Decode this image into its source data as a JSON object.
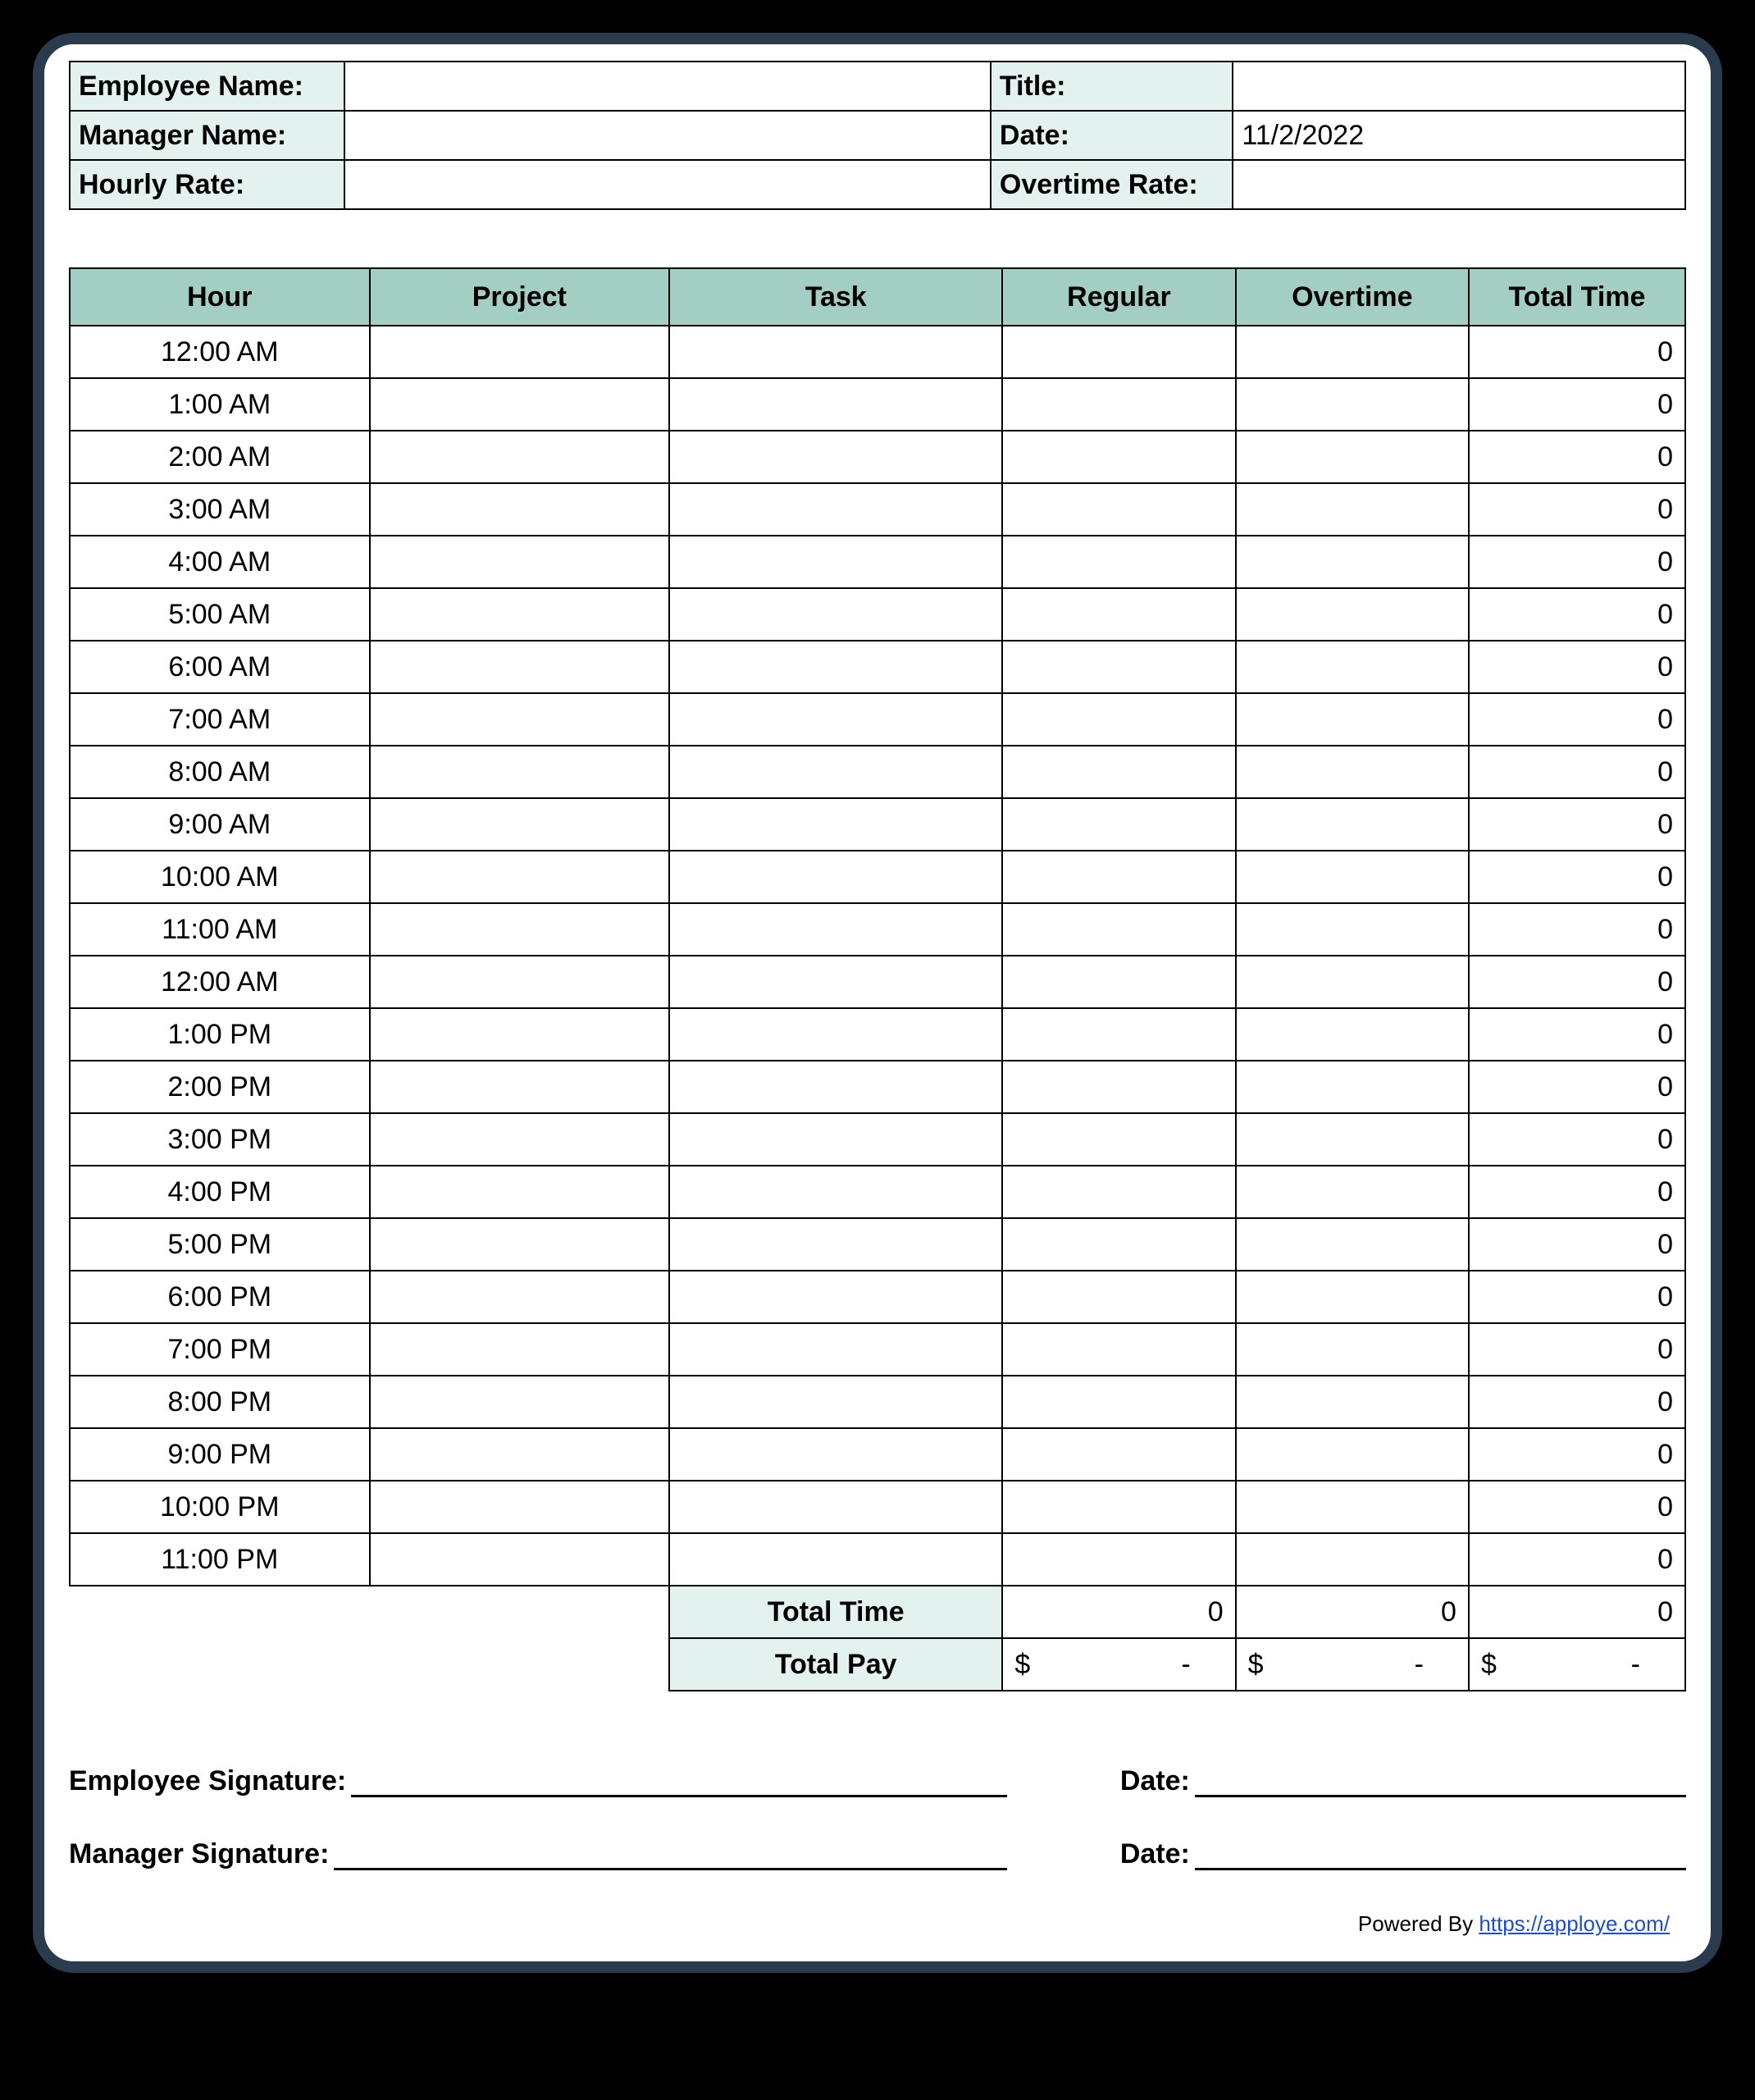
{
  "info": {
    "employee_name_label": "Employee Name:",
    "employee_name_value": "",
    "title_label": "Title:",
    "title_value": "",
    "manager_name_label": "Manager Name:",
    "manager_name_value": "",
    "date_label": "Date:",
    "date_value": "11/2/2022",
    "hourly_rate_label": "Hourly Rate:",
    "hourly_rate_value": "",
    "overtime_rate_label": "Overtime Rate:",
    "overtime_rate_value": ""
  },
  "headers": {
    "hour": "Hour",
    "project": "Project",
    "task": "Task",
    "regular": "Regular",
    "overtime": "Overtime",
    "total_time": "Total Time"
  },
  "rows": [
    {
      "hour": "12:00 AM",
      "project": "",
      "task": "",
      "regular": "",
      "overtime": "",
      "total": "0"
    },
    {
      "hour": "1:00 AM",
      "project": "",
      "task": "",
      "regular": "",
      "overtime": "",
      "total": "0"
    },
    {
      "hour": "2:00 AM",
      "project": "",
      "task": "",
      "regular": "",
      "overtime": "",
      "total": "0"
    },
    {
      "hour": "3:00 AM",
      "project": "",
      "task": "",
      "regular": "",
      "overtime": "",
      "total": "0"
    },
    {
      "hour": "4:00 AM",
      "project": "",
      "task": "",
      "regular": "",
      "overtime": "",
      "total": "0"
    },
    {
      "hour": "5:00 AM",
      "project": "",
      "task": "",
      "regular": "",
      "overtime": "",
      "total": "0"
    },
    {
      "hour": "6:00 AM",
      "project": "",
      "task": "",
      "regular": "",
      "overtime": "",
      "total": "0"
    },
    {
      "hour": "7:00 AM",
      "project": "",
      "task": "",
      "regular": "",
      "overtime": "",
      "total": "0"
    },
    {
      "hour": "8:00 AM",
      "project": "",
      "task": "",
      "regular": "",
      "overtime": "",
      "total": "0"
    },
    {
      "hour": "9:00 AM",
      "project": "",
      "task": "",
      "regular": "",
      "overtime": "",
      "total": "0"
    },
    {
      "hour": "10:00 AM",
      "project": "",
      "task": "",
      "regular": "",
      "overtime": "",
      "total": "0"
    },
    {
      "hour": "11:00 AM",
      "project": "",
      "task": "",
      "regular": "",
      "overtime": "",
      "total": "0"
    },
    {
      "hour": "12:00 AM",
      "project": "",
      "task": "",
      "regular": "",
      "overtime": "",
      "total": "0"
    },
    {
      "hour": "1:00 PM",
      "project": "",
      "task": "",
      "regular": "",
      "overtime": "",
      "total": "0"
    },
    {
      "hour": "2:00 PM",
      "project": "",
      "task": "",
      "regular": "",
      "overtime": "",
      "total": "0"
    },
    {
      "hour": "3:00 PM",
      "project": "",
      "task": "",
      "regular": "",
      "overtime": "",
      "total": "0"
    },
    {
      "hour": "4:00 PM",
      "project": "",
      "task": "",
      "regular": "",
      "overtime": "",
      "total": "0"
    },
    {
      "hour": "5:00 PM",
      "project": "",
      "task": "",
      "regular": "",
      "overtime": "",
      "total": "0"
    },
    {
      "hour": "6:00 PM",
      "project": "",
      "task": "",
      "regular": "",
      "overtime": "",
      "total": "0"
    },
    {
      "hour": "7:00 PM",
      "project": "",
      "task": "",
      "regular": "",
      "overtime": "",
      "total": "0"
    },
    {
      "hour": "8:00 PM",
      "project": "",
      "task": "",
      "regular": "",
      "overtime": "",
      "total": "0"
    },
    {
      "hour": "9:00 PM",
      "project": "",
      "task": "",
      "regular": "",
      "overtime": "",
      "total": "0"
    },
    {
      "hour": "10:00 PM",
      "project": "",
      "task": "",
      "regular": "",
      "overtime": "",
      "total": "0"
    },
    {
      "hour": "11:00 PM",
      "project": "",
      "task": "",
      "regular": "",
      "overtime": "",
      "total": "0"
    }
  ],
  "totals": {
    "total_time_label": "Total Time",
    "regular_total": "0",
    "overtime_total": "0",
    "grand_total": "0",
    "total_pay_label": "Total Pay",
    "pay_regular_currency": "$",
    "pay_regular_value": "-",
    "pay_overtime_currency": "$",
    "pay_overtime_value": "-",
    "pay_total_currency": "$",
    "pay_total_value": "-"
  },
  "signatures": {
    "employee_sig_label": "Employee Signature:",
    "manager_sig_label": "Manager Signature:",
    "date_label": "Date:"
  },
  "footer": {
    "powered_by": "Powered By ",
    "link_text": "https://apploye.com/"
  }
}
